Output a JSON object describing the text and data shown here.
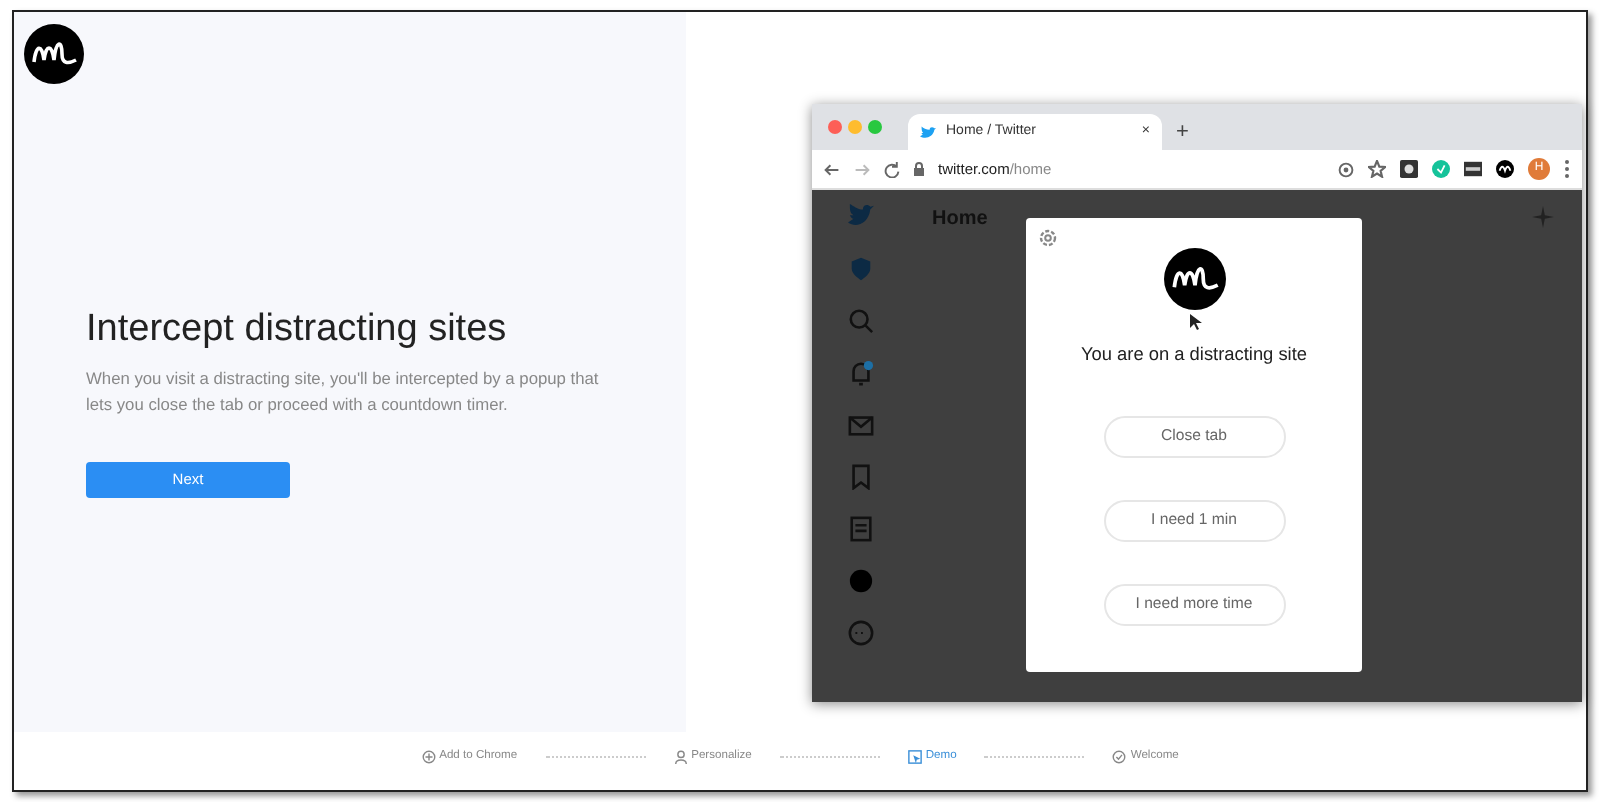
{
  "intro": {
    "heading": "Intercept distracting sites",
    "description": "When you visit a distracting site, you'll be intercepted by a popup that lets you close the tab or proceed with a countdown timer.",
    "button": "Next"
  },
  "browser": {
    "tab_title": "Home / Twitter",
    "new_tab": "+",
    "close_tab": "×",
    "url_host": "twitter.com",
    "url_path": "/home",
    "avatar": "H",
    "page_heading": "Home",
    "popup": {
      "title": "You are on a distracting site",
      "buttons": [
        "Close tab",
        "I need 1 min",
        "I need more time"
      ]
    }
  },
  "steps": [
    {
      "kind": "add",
      "label": "Add to Chrome",
      "selected": false
    },
    {
      "kind": "person",
      "label": "Personalize",
      "selected": false
    },
    {
      "kind": "demo",
      "label": "Demo",
      "selected": true
    },
    {
      "kind": "check",
      "label": "Welcome",
      "selected": false
    }
  ]
}
